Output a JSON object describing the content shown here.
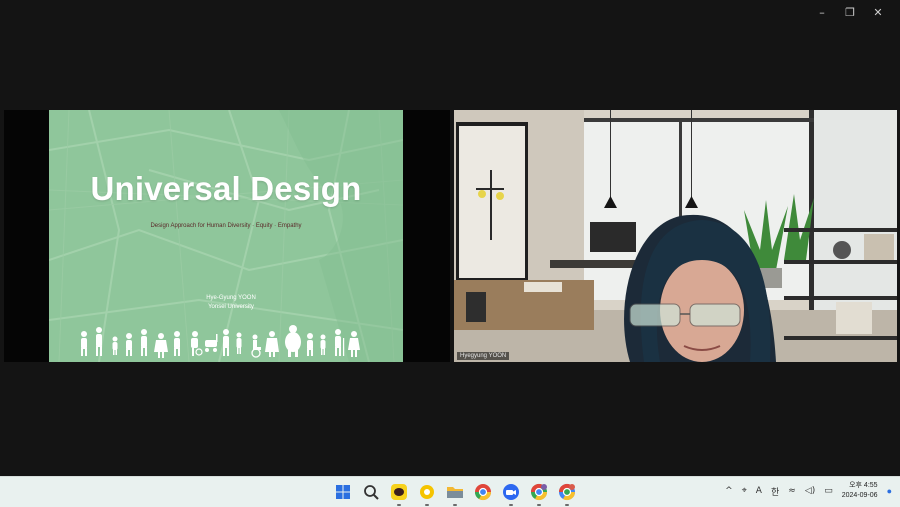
{
  "window": {
    "controls": {
      "minimize": "–",
      "restore": "❐",
      "close": "✕"
    }
  },
  "share": {
    "title": "Universal Design",
    "subtitle": "Design  Approach for Human Diversity · Equity · Empathy",
    "author_name": "Hye-Gyung YOON",
    "author_org": "Yonsei University",
    "colors": {
      "slide_bg": "#8fc69b",
      "title": "#ffffff"
    }
  },
  "video": {
    "participant": "Hyegyung YOON"
  },
  "taskbar": {
    "apps": [
      {
        "name": "windows-start-icon",
        "color": "#2b6fe0"
      },
      {
        "name": "search-icon",
        "color": "#333333"
      },
      {
        "name": "kakaotalk-icon",
        "color": "#f7d21e"
      },
      {
        "name": "kakao-icon",
        "color": "#f5c400"
      },
      {
        "name": "file-explorer-icon",
        "color": "#f2b833"
      },
      {
        "name": "chrome-icon",
        "color": "#e0463a"
      },
      {
        "name": "zoom-icon",
        "color": "#2d68f0"
      },
      {
        "name": "chrome-profile-icon",
        "color": "#34a853"
      },
      {
        "name": "chrome-profile-2-icon",
        "color": "#4285f4"
      }
    ],
    "tray": {
      "chevron": "^",
      "location": "⌖",
      "font": "A",
      "ime": "한",
      "wifi": "≈",
      "volume": "◁)",
      "battery": "▭"
    },
    "clock": {
      "time": "오후 4:55",
      "date": "2024-09-06"
    }
  }
}
